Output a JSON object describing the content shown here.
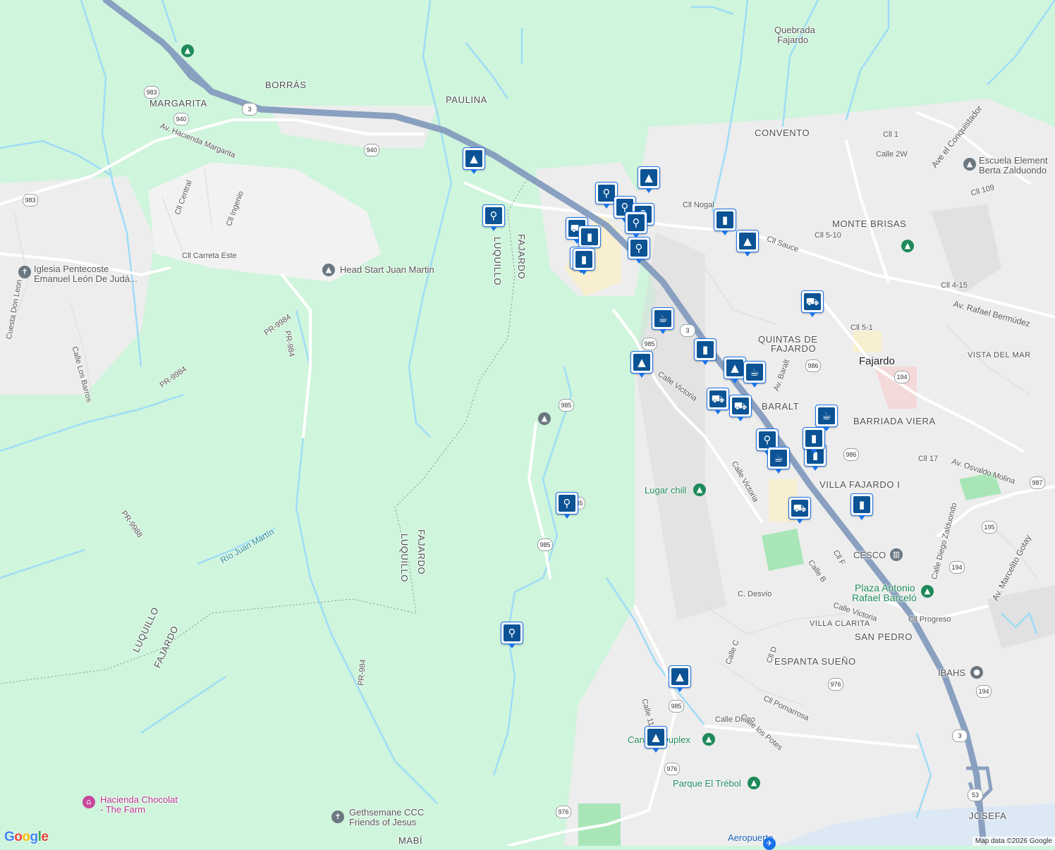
{
  "map": {
    "attribution": "Map data ©2026 Google",
    "logo": "Google",
    "colors": {
      "land": "#cff5dc",
      "urban": "#ededed",
      "road": "#ffffff",
      "highway": "#8aa0c0",
      "water": "#9fdcf7",
      "marker": "#0b5394"
    }
  },
  "labels": {
    "area": [
      {
        "id": "borras",
        "text": "BORRÁS"
      },
      {
        "id": "margarita",
        "text": "MARGARITA"
      },
      {
        "id": "paulina",
        "text": "PAULINA"
      },
      {
        "id": "convento",
        "text": "CONVENTO"
      },
      {
        "id": "monte-brisas",
        "text": "MONTE BRISAS"
      },
      {
        "id": "quintas",
        "text": "QUINTAS DE"
      },
      {
        "id": "quintas2",
        "text": "FAJARDO"
      },
      {
        "id": "vista-del-mar",
        "text": "VISTA DEL MAR"
      },
      {
        "id": "baralt",
        "text": "BARALT"
      },
      {
        "id": "barriada-viera",
        "text": "BARRIADA VIERA"
      },
      {
        "id": "villa-fajardo",
        "text": "VILLA FAJARDO I"
      },
      {
        "id": "villa-clarita",
        "text": "VILLA CLARITA"
      },
      {
        "id": "san-pedro",
        "text": "SAN PEDRO"
      },
      {
        "id": "espanta-sueno",
        "text": "ESPANTA SUEÑO"
      },
      {
        "id": "josefa",
        "text": "JOSEFA"
      },
      {
        "id": "mabi",
        "text": "MABÍ"
      },
      {
        "id": "luquillo-1",
        "text": "LUQUILLO"
      },
      {
        "id": "fajardo-1",
        "text": "FAJARDO"
      },
      {
        "id": "luquillo-2",
        "text": "LUQUILLO"
      },
      {
        "id": "fajardo-2",
        "text": "FAJARDO"
      },
      {
        "id": "luquillo-3",
        "text": "LUQUILLO"
      },
      {
        "id": "fajardo-3",
        "text": "FAJARDO"
      },
      {
        "id": "quebrada",
        "text": "Quebrada"
      },
      {
        "id": "quebrada2",
        "text": "Fajardo"
      }
    ],
    "town": [
      {
        "id": "fajardo-town",
        "text": "Fajardo"
      }
    ],
    "streets": [
      {
        "id": "av-hacienda",
        "text": "Av. Hacienda Margarita"
      },
      {
        "id": "cll-central",
        "text": "Cll Central"
      },
      {
        "id": "cll-ingenio",
        "text": "Cll Ingenio"
      },
      {
        "id": "cll-carreta",
        "text": "Cll Carreta Este"
      },
      {
        "id": "pr-9984a",
        "text": "PR-9984"
      },
      {
        "id": "pr-9984b",
        "text": "PR-9984"
      },
      {
        "id": "pr-984",
        "text": "PR-984"
      },
      {
        "id": "pr-9988",
        "text": "PR-9988"
      },
      {
        "id": "pr-984b",
        "text": "PR-984"
      },
      {
        "id": "calle-los-barros",
        "text": "Calle Los Barros"
      },
      {
        "id": "cuesta-don-leon",
        "text": "Cuesta Don Leon"
      },
      {
        "id": "rio-juan-martin",
        "text": "Río Juan Martín"
      },
      {
        "id": "calle-victoria",
        "text": "Calle Victoria"
      },
      {
        "id": "calle-victoria2",
        "text": "Calle Victoria"
      },
      {
        "id": "av-rafael",
        "text": "Av. Rafael Bermúdez"
      },
      {
        "id": "ave-conquistador",
        "text": "Ave el Conquistador"
      },
      {
        "id": "av-osvaldo",
        "text": "Av. Osvaldo Molina"
      },
      {
        "id": "av-marcelito",
        "text": "Av. Marcelito Gotay"
      },
      {
        "id": "calle-diego-z",
        "text": "Calle Diego Zalduondo"
      },
      {
        "id": "c-desvio",
        "text": "C. Desvío"
      },
      {
        "id": "calle-victoria3",
        "text": "Calle Victoria"
      },
      {
        "id": "cll-progreso",
        "text": "Cll Progreso"
      },
      {
        "id": "calle-diego",
        "text": "Calle Diego"
      },
      {
        "id": "cll-pomarrosa",
        "text": "Cll Pomarrosa"
      },
      {
        "id": "calle-potes",
        "text": "Calle los Potes"
      },
      {
        "id": "cll-nogal",
        "text": "Cll Nogal"
      },
      {
        "id": "cll-sauce",
        "text": "Cll Sauce"
      },
      {
        "id": "cll-1",
        "text": "Cll 1"
      },
      {
        "id": "calle-2w",
        "text": "Calle 2W"
      },
      {
        "id": "cll-109",
        "text": "Cll 109"
      },
      {
        "id": "cll-4-15",
        "text": "Cll 4-15"
      },
      {
        "id": "cll-5-1",
        "text": "Cll 5-1"
      },
      {
        "id": "cll-17",
        "text": "Cll 17"
      },
      {
        "id": "cll-5-10",
        "text": "Cll 5-10"
      },
      {
        "id": "c-desvio2",
        "text": "Calle B"
      },
      {
        "id": "cll-f",
        "text": "Cll F"
      },
      {
        "id": "calle-c",
        "text": "Calle C"
      },
      {
        "id": "cll-d",
        "text": "Cll D"
      },
      {
        "id": "calle-11",
        "text": "Calle 11"
      },
      {
        "id": "av-baralt",
        "text": "Av. Baralt"
      }
    ],
    "pois": [
      {
        "id": "iglesia",
        "text": "Iglesia Pentecoste",
        "text2": "Emanuel León De Judá...",
        "kind": "s",
        "icon": "cross-icon"
      },
      {
        "id": "head-start",
        "text": "Head Start Juan Martin",
        "kind": "s",
        "icon": "school-icon"
      },
      {
        "id": "lugar-chill",
        "text": "Lugar chill",
        "kind": "g",
        "icon": "park-icon"
      },
      {
        "id": "cesco",
        "text": "CESCO",
        "kind": "s",
        "icon": "government-icon"
      },
      {
        "id": "plaza",
        "text": "Plaza Antonio",
        "text2": "Rafael Barceló",
        "kind": "g",
        "icon": "park-icon"
      },
      {
        "id": "escuela",
        "text": "Escuela Element",
        "text2": "Berta Zalduondo",
        "kind": "s",
        "icon": "school-icon"
      },
      {
        "id": "ibahs",
        "text": "IBAHS",
        "kind": "s",
        "icon": "pin-icon"
      },
      {
        "id": "cancha",
        "text": "Cancha Duplex",
        "kind": "g",
        "icon": "park-icon"
      },
      {
        "id": "parque-trebol",
        "text": "Parque El Trébol",
        "kind": "g",
        "icon": "park-icon"
      },
      {
        "id": "hacienda",
        "text": "Hacienda Chocolat",
        "text2": "- The Farm",
        "kind": "p",
        "icon": "store-icon"
      },
      {
        "id": "gethsemane",
        "text": "Gethsemane CCC",
        "text2": "Friends of Jesus",
        "kind": "s",
        "icon": "cross-icon"
      },
      {
        "id": "aeropuerto",
        "text": "Aeropuerto",
        "kind": "b",
        "icon": "airport-icon"
      }
    ],
    "shields": [
      "3",
      "983",
      "940",
      "940",
      "983",
      "985",
      "985",
      "985",
      "985",
      "986",
      "986",
      "194",
      "195",
      "194",
      "987",
      "976",
      "976",
      "976",
      "3",
      "53",
      "985",
      "194",
      "3"
    ]
  },
  "markers": [
    {
      "type": "school",
      "icon": "graduation-cap-icon"
    },
    {
      "type": "restaurant",
      "icon": "fork-knife-icon"
    },
    {
      "type": "restaurant",
      "icon": "fork-knife-icon"
    },
    {
      "type": "school",
      "icon": "graduation-cap-icon"
    },
    {
      "type": "restaurant",
      "icon": "fork-knife-icon"
    },
    {
      "type": "restaurant",
      "icon": "fork-knife-icon"
    },
    {
      "type": "restaurant",
      "icon": "fork-knife-icon"
    },
    {
      "type": "grocery",
      "icon": "cart-icon"
    },
    {
      "type": "shopping",
      "icon": "bag-icon"
    },
    {
      "type": "shopping",
      "icon": "bag-icon"
    },
    {
      "type": "shopping",
      "icon": "bag-icon"
    },
    {
      "type": "school",
      "icon": "graduation-cap-icon"
    },
    {
      "type": "restaurant",
      "icon": "fork-knife-icon"
    },
    {
      "type": "cafe",
      "icon": "coffee-icon"
    },
    {
      "type": "grocery",
      "icon": "cart-icon"
    },
    {
      "type": "shopping",
      "icon": "bag-icon"
    },
    {
      "type": "school",
      "icon": "graduation-cap-icon"
    },
    {
      "type": "shopping",
      "icon": "bag-icon"
    },
    {
      "type": "school",
      "icon": "graduation-cap-icon"
    },
    {
      "type": "cafe",
      "icon": "coffee-icon"
    },
    {
      "type": "grocery",
      "icon": "cart-icon"
    },
    {
      "type": "grocery",
      "icon": "cart-icon"
    },
    {
      "type": "cafe",
      "icon": "coffee-icon"
    },
    {
      "type": "restaurant",
      "icon": "fork-knife-icon"
    },
    {
      "type": "shopping",
      "icon": "bag-icon"
    },
    {
      "type": "cafe",
      "icon": "coffee-icon"
    },
    {
      "type": "shopping",
      "icon": "bag-icon"
    },
    {
      "type": "grocery",
      "icon": "cart-icon"
    },
    {
      "type": "shopping",
      "icon": "bag-icon"
    },
    {
      "type": "restaurant",
      "icon": "fork-knife-icon"
    },
    {
      "type": "restaurant",
      "icon": "fork-knife-icon"
    },
    {
      "type": "school",
      "icon": "graduation-cap-icon"
    },
    {
      "type": "school",
      "icon": "graduation-cap-icon"
    }
  ]
}
